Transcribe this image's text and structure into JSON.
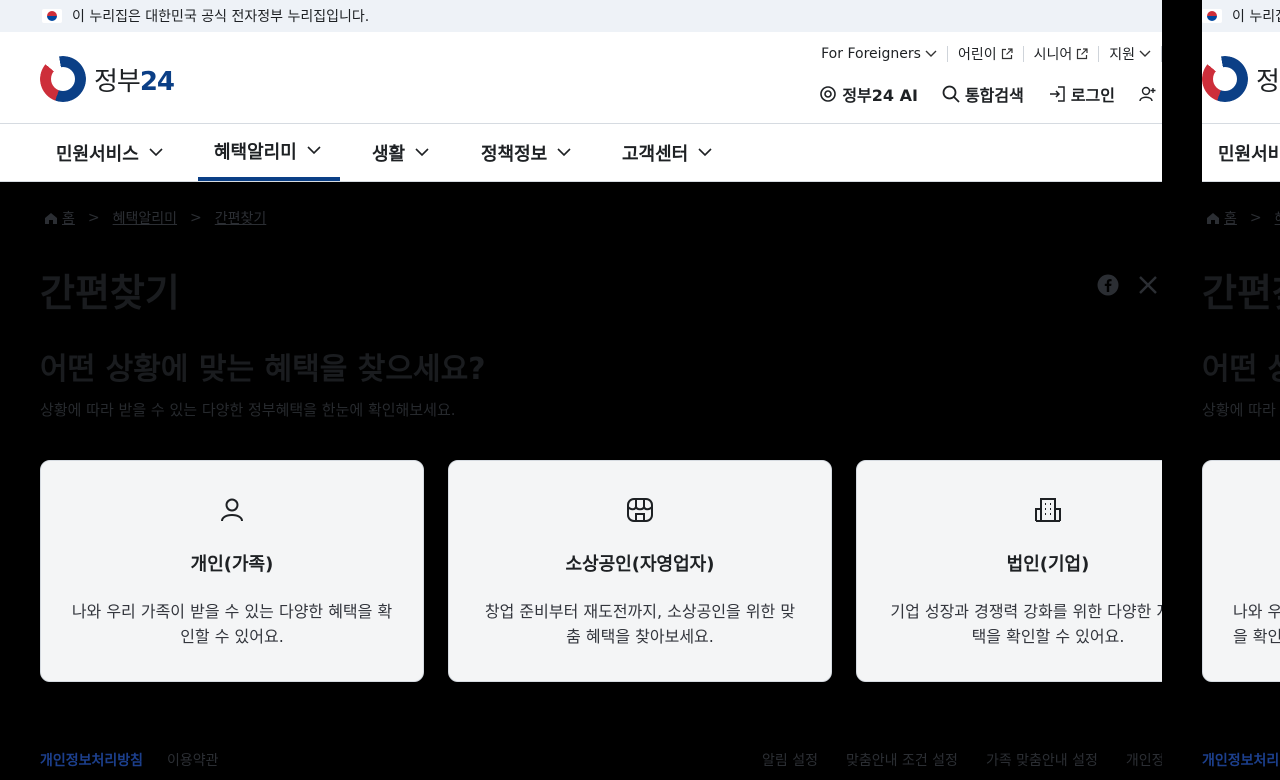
{
  "gov_banner": {
    "text": "이 누리집은 대한민국 공식 전자정부 누리집입니다."
  },
  "logo": {
    "name": "정부",
    "num": "24"
  },
  "utility": [
    {
      "label": "For Foreigners",
      "icon": "chevron-down-icon"
    },
    {
      "label": "어린이",
      "icon": "external-link-icon"
    },
    {
      "label": "시니어",
      "icon": "external-link-icon"
    },
    {
      "label": "지원",
      "icon": "chevron-down-icon"
    }
  ],
  "actions": {
    "ai": "정부24 AI",
    "search": "통합검색",
    "login": "로그인"
  },
  "gnb": [
    {
      "label": "민원서비스"
    },
    {
      "label": "혜택알리미",
      "active": true
    },
    {
      "label": "생활"
    },
    {
      "label": "정책정보"
    },
    {
      "label": "고객센터"
    }
  ],
  "breadcrumb": {
    "home": "홈",
    "level1": "혜택알리미",
    "level2": "간편찾기"
  },
  "page": {
    "title": "간편찾기",
    "headline": "어떤 상황에 맞는 혜택을 찾으세요?",
    "subline": "상황에 따라 받을 수 있는 다양한 정부혜택을 한눈에 확인해보세요."
  },
  "cards": [
    {
      "title": "개인(가족)",
      "desc": "나와 우리 가족이 받을 수 있는 다양한 혜택을 확인할 수 있어요.",
      "icon": "person-icon"
    },
    {
      "title": "소상공인(자영업자)",
      "desc": "창업 준비부터 재도전까지, 소상공인을 위한 맞춤 혜택을 찾아보세요.",
      "icon": "store-icon"
    },
    {
      "title": "법인(기업)",
      "desc": "기업 성장과 경쟁력 강화를 위한 다양한 지원 혜택을 확인할 수 있어요.",
      "icon": "building-icon"
    }
  ],
  "footer": {
    "privacy": "개인정보처리방침",
    "terms": "이용약관",
    "links": [
      "알림 설정",
      "맞춤안내 조건 설정",
      "가족 맞춤안내 설정",
      "개인정보"
    ]
  },
  "colors": {
    "brand_blue": "#0b3f86",
    "brand_red": "#cd2e3a",
    "overlay": "#000000"
  }
}
